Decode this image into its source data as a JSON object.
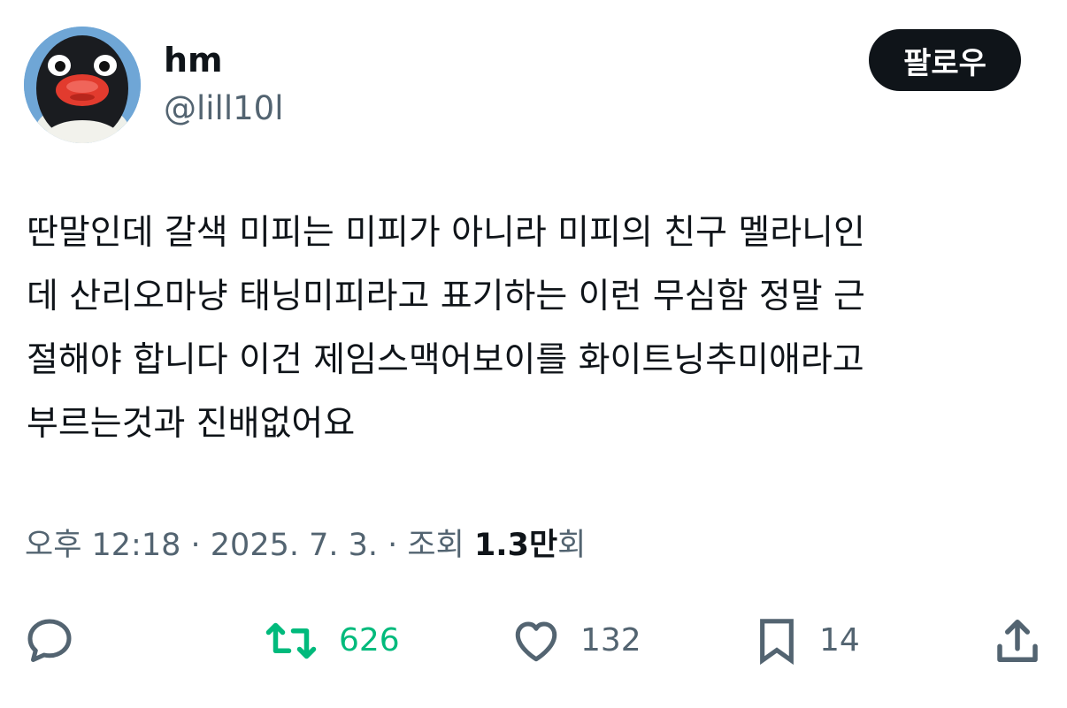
{
  "author": {
    "display_name": "hm",
    "handle": "@lill10l"
  },
  "follow_button": {
    "label": "팔로우"
  },
  "tweet": {
    "text": "딴말인데 갈색 미피는 미피가 아니라 미피의 친구 멜라니인\n데 산리오마냥 태닝미피라고 표기하는 이런 무심함 정말 근\n절해야 합니다 이건 제임스맥어보이를 화이트닝추미애라고\n부르는것과 진배없어요"
  },
  "meta": {
    "time": "오후 12:18",
    "separator": " · ",
    "date": "2025. 7. 3.",
    "views_label": "조회 ",
    "views_count": "1.3만",
    "views_suffix": "회"
  },
  "actions": {
    "reply": {
      "icon": "reply-icon"
    },
    "retweet": {
      "icon": "retweet-icon",
      "count": "626"
    },
    "like": {
      "icon": "heart-icon",
      "count": "132"
    },
    "bookmark": {
      "icon": "bookmark-icon",
      "count": "14"
    },
    "share": {
      "icon": "share-icon"
    }
  },
  "colors": {
    "text_primary": "#0f1419",
    "text_secondary": "#536471",
    "retweet_active": "#00ba7c",
    "follow_button_bg": "#0f1419"
  }
}
